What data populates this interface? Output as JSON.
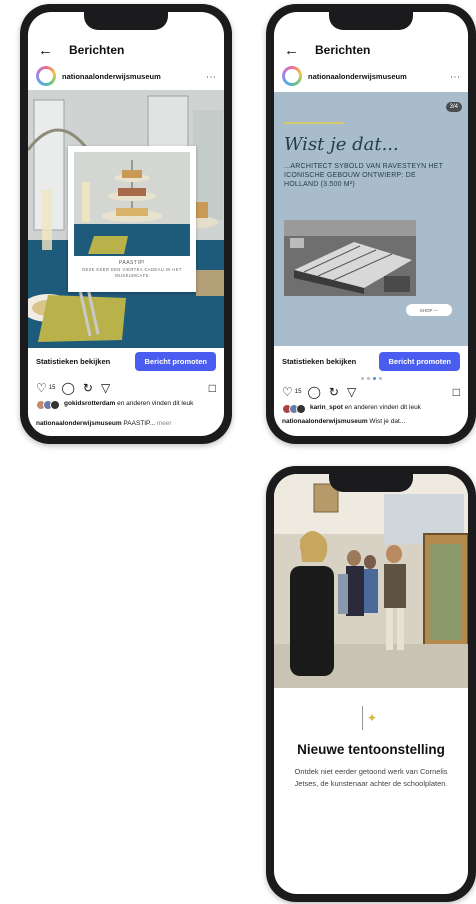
{
  "phone1": {
    "header_title": "Berichten",
    "account": "nationaalonderwijsmuseum",
    "card_label_1": "PAASTIP!",
    "card_label_2": "DEZE KEER EEN VIERTEA CADEAU IN HET MUSEUMCAFE",
    "stats_label": "Statistieken bekijken",
    "promote_label": "Bericht promoten",
    "like_count": "15",
    "likes_user": "gokidsrotterdam",
    "likes_rest": " en anderen vinden dit leuk",
    "caption_account": "nationaalonderwijsmuseum",
    "caption_text": " PAASTIP...",
    "caption_more": " meer"
  },
  "phone2": {
    "header_title": "Berichten",
    "account": "nationaalonderwijsmuseum",
    "counter": "3/4",
    "headline": "Wist je dat...",
    "body": "...ARCHITECT SYBOLD VAN RAVESTEYN HET ICONISCHE GEBOUW ONTWIERP: DE HOLLAND (3.500 M²)",
    "shop_label": "SHOP",
    "stats_label": "Statistieken bekijken",
    "promote_label": "Bericht promoten",
    "like_count": "15",
    "likes_user": "karin_spot",
    "likes_rest": " en anderen vinden dit leuk",
    "caption_account": "nationaalonderwijsmuseum",
    "caption_text": " Wist je dat..."
  },
  "phone3": {
    "title": "Nieuwe tentoonstelling",
    "body": "Ontdek niet eerder getoond werk van Cornelis Jetses, de kunstenaar achter de schoolplaten."
  },
  "colors": {
    "promote": "#4a5df0",
    "poster_bg": "#a9bccc",
    "tablecloth": "#1e5a7a",
    "napkin": "#b9b24a"
  }
}
